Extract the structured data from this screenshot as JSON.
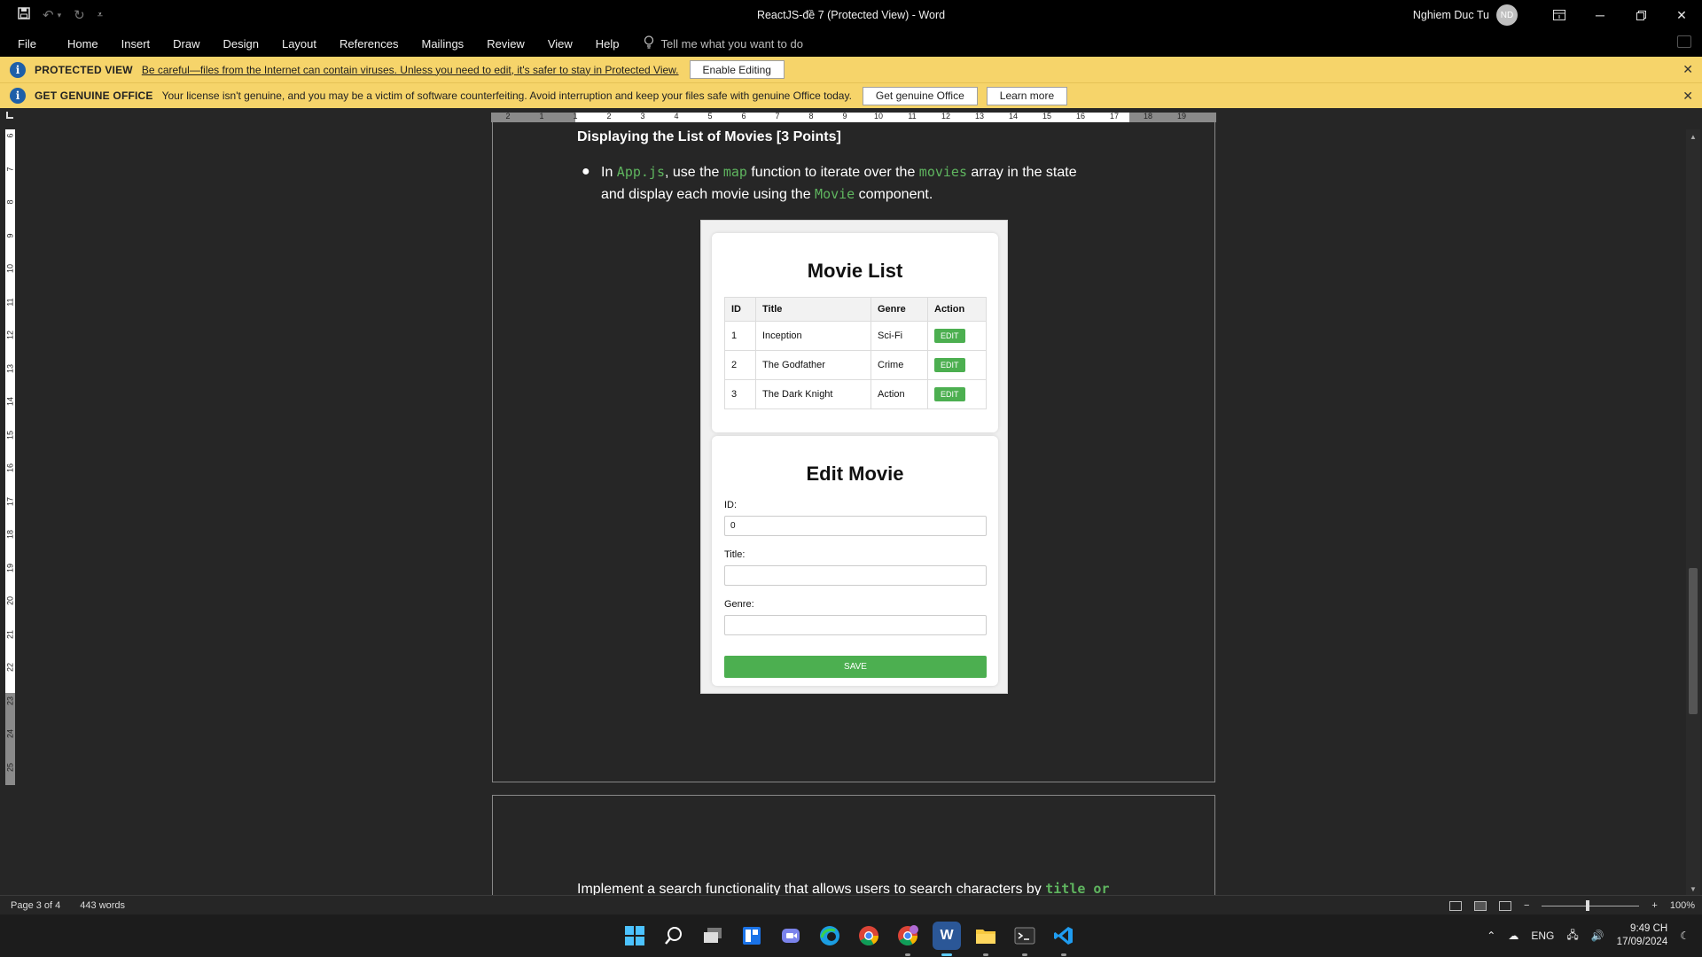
{
  "window": {
    "title": "ReactJS-đề 7 (Protected View)  -  Word",
    "user_name": "Nghiem Duc Tu",
    "user_initials": "ND"
  },
  "icons": {
    "save": "save-icon",
    "undo": "undo-icon",
    "redo": "redo-icon",
    "customize": "customize-qat-icon",
    "ribbon_display": "ribbon-display-icon",
    "minimize": "minimize-icon",
    "restore": "restore-icon",
    "close": "close-icon",
    "lightbulb": "lightbulb-icon",
    "info": "info-icon"
  },
  "menu": {
    "items": [
      "File",
      "Home",
      "Insert",
      "Draw",
      "Design",
      "Layout",
      "References",
      "Mailings",
      "Review",
      "View",
      "Help"
    ],
    "tell_me": "Tell me what you want to do"
  },
  "protected_view": {
    "title": "PROTECTED VIEW",
    "message": "Be careful—files from the Internet can contain viruses. Unless you need to edit, it's safer to stay in Protected View.",
    "button": "Enable Editing"
  },
  "genuine_office": {
    "title": "GET GENUINE OFFICE",
    "message": "Your license isn't genuine, and you may be a victim of software counterfeiting. Avoid interruption and keep your files safe with genuine Office today.",
    "button_get": "Get genuine Office",
    "button_learn": "Learn more"
  },
  "ruler": {
    "h_numbers": [
      "2",
      "1",
      "1",
      "2",
      "3",
      "4",
      "5",
      "6",
      "7",
      "8",
      "9",
      "10",
      "11",
      "12",
      "13",
      "14",
      "15",
      "16",
      "17",
      "18",
      "19"
    ],
    "v_numbers": [
      "6",
      "7",
      "8",
      "9",
      "10",
      "11",
      "12",
      "13",
      "14",
      "15",
      "16",
      "17",
      "18",
      "19",
      "20",
      "21",
      "22",
      "23",
      "24",
      "25"
    ]
  },
  "document": {
    "heading": "Displaying the List of Movies [3 Points]",
    "bullet": {
      "t1": "In ",
      "c1": "App.js",
      "t2": ", use the ",
      "c2": "map",
      "t3": " function to iterate over the ",
      "c3": "movies",
      "t4": " array in the state and display each movie using the ",
      "c4": "Movie",
      "t5": " component."
    },
    "page2_text": "Implement a search functionality that allows users to search characters by ",
    "page2_code": "title or"
  },
  "embedded": {
    "list_title": "Movie List",
    "columns": [
      "ID",
      "Title",
      "Genre",
      "Action"
    ],
    "rows": [
      {
        "id": "1",
        "title": "Inception",
        "genre": "Sci-Fi",
        "action": "EDIT"
      },
      {
        "id": "2",
        "title": "The Godfather",
        "genre": "Crime",
        "action": "EDIT"
      },
      {
        "id": "3",
        "title": "The Dark Knight",
        "genre": "Action",
        "action": "EDIT"
      }
    ],
    "edit_title": "Edit Movie",
    "id_label": "ID:",
    "id_value": "0",
    "title_label": "Title:",
    "title_value": "",
    "genre_label": "Genre:",
    "genre_value": "",
    "save_label": "SAVE"
  },
  "status": {
    "page": "Page 3 of 4",
    "words": "443 words",
    "zoom": "100%"
  },
  "taskbar": {
    "apps": [
      "windows-start-icon",
      "search-icon",
      "task-view-icon",
      "widgets-icon",
      "teams-chat-icon",
      "edge-icon",
      "chrome-icon",
      "chrome-profile-icon",
      "word-icon",
      "file-explorer-icon",
      "terminal-icon",
      "vscode-icon"
    ],
    "lang": "ENG",
    "time": "9:49 CH",
    "date": "17/09/2024"
  },
  "colors": {
    "accent_green": "#4caf50",
    "code_green": "#5fb55f",
    "infobar_yellow": "#f6d46a",
    "doc_background": "#262626"
  }
}
